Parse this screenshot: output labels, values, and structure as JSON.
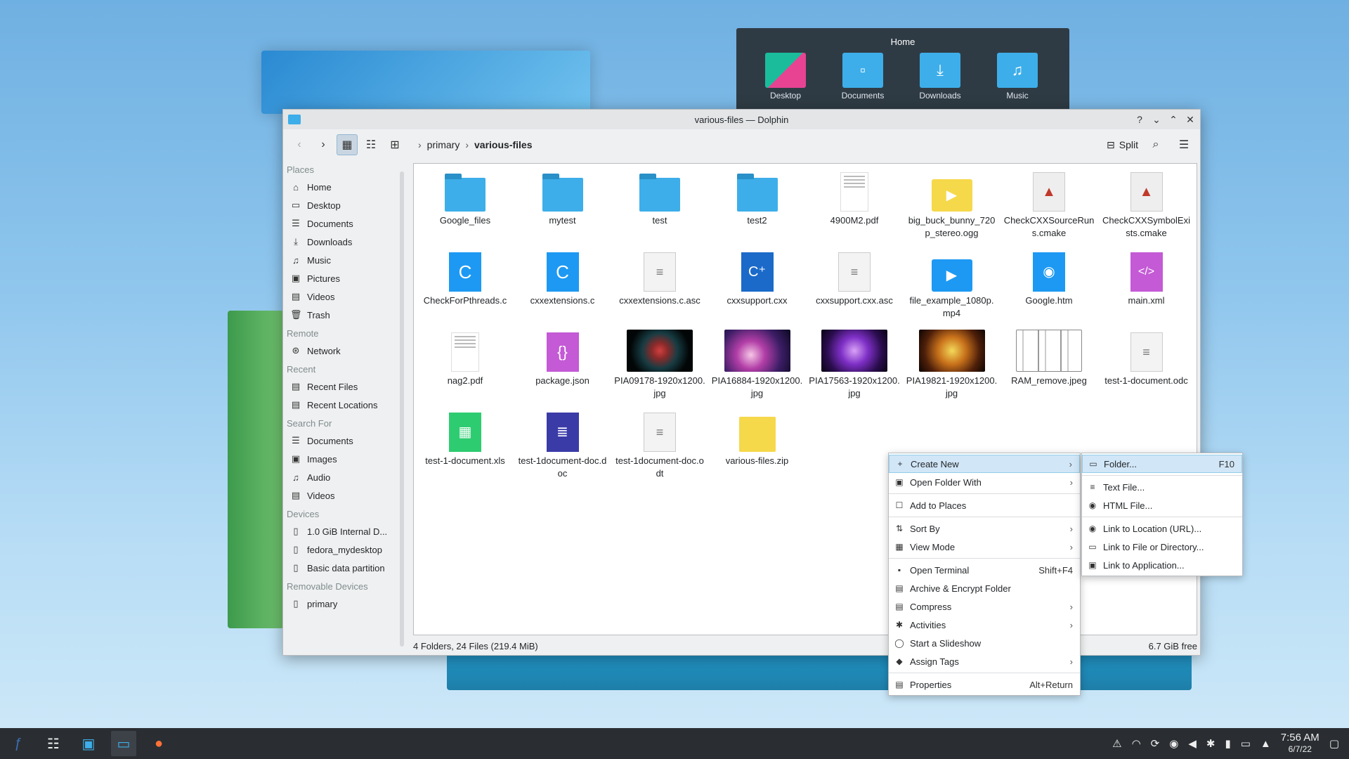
{
  "home_popup": {
    "title": "Home",
    "items": [
      {
        "label": "Desktop"
      },
      {
        "label": "Documents"
      },
      {
        "label": "Downloads"
      },
      {
        "label": "Music"
      }
    ]
  },
  "window": {
    "title": "various-files — Dolphin",
    "controls": {
      "help": "?",
      "minimize": "⌄",
      "maximize": "⌃",
      "close": "✕"
    }
  },
  "toolbar": {
    "breadcrumbs": [
      "primary",
      "various-files"
    ],
    "split_label": "Split"
  },
  "sidebar": {
    "sections": [
      {
        "title": "Places",
        "items": [
          {
            "label": "Home",
            "icon": "home-icon",
            "glyph": "⌂"
          },
          {
            "label": "Desktop",
            "icon": "desktop-icon",
            "glyph": "▭"
          },
          {
            "label": "Documents",
            "icon": "documents-icon",
            "glyph": "☰"
          },
          {
            "label": "Downloads",
            "icon": "downloads-icon",
            "glyph": "⤓"
          },
          {
            "label": "Music",
            "icon": "music-icon",
            "glyph": "♫"
          },
          {
            "label": "Pictures",
            "icon": "pictures-icon",
            "glyph": "▣"
          },
          {
            "label": "Videos",
            "icon": "videos-icon",
            "glyph": "▤"
          },
          {
            "label": "Trash",
            "icon": "trash-icon",
            "glyph": "🗑"
          }
        ]
      },
      {
        "title": "Remote",
        "items": [
          {
            "label": "Network",
            "icon": "network-icon",
            "glyph": "⊛"
          }
        ]
      },
      {
        "title": "Recent",
        "items": [
          {
            "label": "Recent Files",
            "icon": "recent-files-icon",
            "glyph": "▤"
          },
          {
            "label": "Recent Locations",
            "icon": "recent-locations-icon",
            "glyph": "▤"
          }
        ]
      },
      {
        "title": "Search For",
        "items": [
          {
            "label": "Documents",
            "icon": "search-documents-icon",
            "glyph": "☰"
          },
          {
            "label": "Images",
            "icon": "search-images-icon",
            "glyph": "▣"
          },
          {
            "label": "Audio",
            "icon": "search-audio-icon",
            "glyph": "♫"
          },
          {
            "label": "Videos",
            "icon": "search-videos-icon",
            "glyph": "▤"
          }
        ]
      },
      {
        "title": "Devices",
        "items": [
          {
            "label": "1.0 GiB Internal D...",
            "icon": "drive-icon",
            "glyph": "▯"
          },
          {
            "label": "fedora_mydesktop",
            "icon": "drive-icon",
            "glyph": "▯"
          },
          {
            "label": "Basic data partition",
            "icon": "drive-icon",
            "glyph": "▯"
          }
        ]
      },
      {
        "title": "Removable Devices",
        "items": [
          {
            "label": "primary",
            "icon": "usb-drive-icon",
            "glyph": "▯"
          }
        ]
      }
    ]
  },
  "files": [
    {
      "name": "Google_files",
      "kind": "folder"
    },
    {
      "name": "mytest",
      "kind": "folder"
    },
    {
      "name": "test",
      "kind": "folder"
    },
    {
      "name": "test2",
      "kind": "folder"
    },
    {
      "name": "4900M2.pdf",
      "kind": "pdf"
    },
    {
      "name": "big_buck_bunny_720p_stereo.ogg",
      "kind": "ogg"
    },
    {
      "name": "CheckCXXSourceRuns.cmake",
      "kind": "cmake"
    },
    {
      "name": "CheckCXXSymbolExists.cmake",
      "kind": "cmake"
    },
    {
      "name": "CheckForPthreads.c",
      "kind": "c"
    },
    {
      "name": "cxxextensions.c",
      "kind": "c"
    },
    {
      "name": "cxxextensions.c.asc",
      "kind": "txt"
    },
    {
      "name": "cxxsupport.cxx",
      "kind": "cpp"
    },
    {
      "name": "cxxsupport.cxx.asc",
      "kind": "txt"
    },
    {
      "name": "file_example_1080p.mp4",
      "kind": "mp4"
    },
    {
      "name": "Google.htm",
      "kind": "htm"
    },
    {
      "name": "main.xml",
      "kind": "xml"
    },
    {
      "name": "nag2.pdf",
      "kind": "pdf"
    },
    {
      "name": "package.json",
      "kind": "json"
    },
    {
      "name": "PIA09178-1920x1200.jpg",
      "kind": "img1"
    },
    {
      "name": "PIA16884-1920x1200.jpg",
      "kind": "img2"
    },
    {
      "name": "PIA17563-1920x1200.jpg",
      "kind": "img3"
    },
    {
      "name": "PIA19821-1920x1200.jpg",
      "kind": "img4"
    },
    {
      "name": "RAM_remove.jpeg",
      "kind": "img5"
    },
    {
      "name": "test-1-document.odc",
      "kind": "txt"
    },
    {
      "name": "test-1-document.xls",
      "kind": "xls"
    },
    {
      "name": "test-1document-doc.doc",
      "kind": "docx"
    },
    {
      "name": "test-1document-doc.odt",
      "kind": "txt"
    },
    {
      "name": "various-files.zip",
      "kind": "zip"
    }
  ],
  "status": {
    "summary": "4 Folders, 24 Files (219.4 MiB)",
    "free": "6.7 GiB free"
  },
  "context_menu": {
    "items": [
      {
        "label": "Create New",
        "icon": "plus-icon",
        "glyph": "+",
        "submenu": true,
        "highlight": true
      },
      {
        "label": "Open Folder With",
        "icon": "open-with-icon",
        "glyph": "▣",
        "submenu": true
      },
      {
        "sep": true
      },
      {
        "label": "Add to Places",
        "icon": "bookmark-icon",
        "glyph": "☐"
      },
      {
        "sep": true
      },
      {
        "label": "Sort By",
        "icon": "sort-icon",
        "glyph": "⇅",
        "submenu": true
      },
      {
        "label": "View Mode",
        "icon": "view-mode-icon",
        "glyph": "▦",
        "submenu": true
      },
      {
        "sep": true
      },
      {
        "label": "Open Terminal",
        "icon": "terminal-icon",
        "glyph": "▪",
        "shortcut": "Shift+F4"
      },
      {
        "label": "Archive & Encrypt Folder",
        "icon": "archive-icon",
        "glyph": "▤"
      },
      {
        "label": "Compress",
        "icon": "compress-icon",
        "glyph": "▤",
        "submenu": true
      },
      {
        "label": "Activities",
        "icon": "activities-icon",
        "glyph": "✱",
        "submenu": true
      },
      {
        "label": "Start a Slideshow",
        "icon": "slideshow-icon",
        "glyph": "◯"
      },
      {
        "label": "Assign Tags",
        "icon": "tag-icon",
        "glyph": "◆",
        "submenu": true
      },
      {
        "sep": true
      },
      {
        "label": "Properties",
        "icon": "properties-icon",
        "glyph": "▤",
        "shortcut": "Alt+Return"
      }
    ]
  },
  "submenu": {
    "items": [
      {
        "label": "Folder...",
        "icon": "folder-icon",
        "glyph": "▭",
        "shortcut": "F10",
        "highlight": true
      },
      {
        "sep": true
      },
      {
        "label": "Text File...",
        "icon": "text-file-icon",
        "glyph": "≡"
      },
      {
        "label": "HTML File...",
        "icon": "html-file-icon",
        "glyph": "◉"
      },
      {
        "sep": true
      },
      {
        "label": "Link to Location (URL)...",
        "icon": "link-url-icon",
        "glyph": "◉"
      },
      {
        "label": "Link to File or Directory...",
        "icon": "link-file-icon",
        "glyph": "▭"
      },
      {
        "label": "Link to Application...",
        "icon": "link-app-icon",
        "glyph": "▣"
      }
    ]
  },
  "taskbar": {
    "time": "7:56 AM",
    "date": "6/7/22"
  }
}
